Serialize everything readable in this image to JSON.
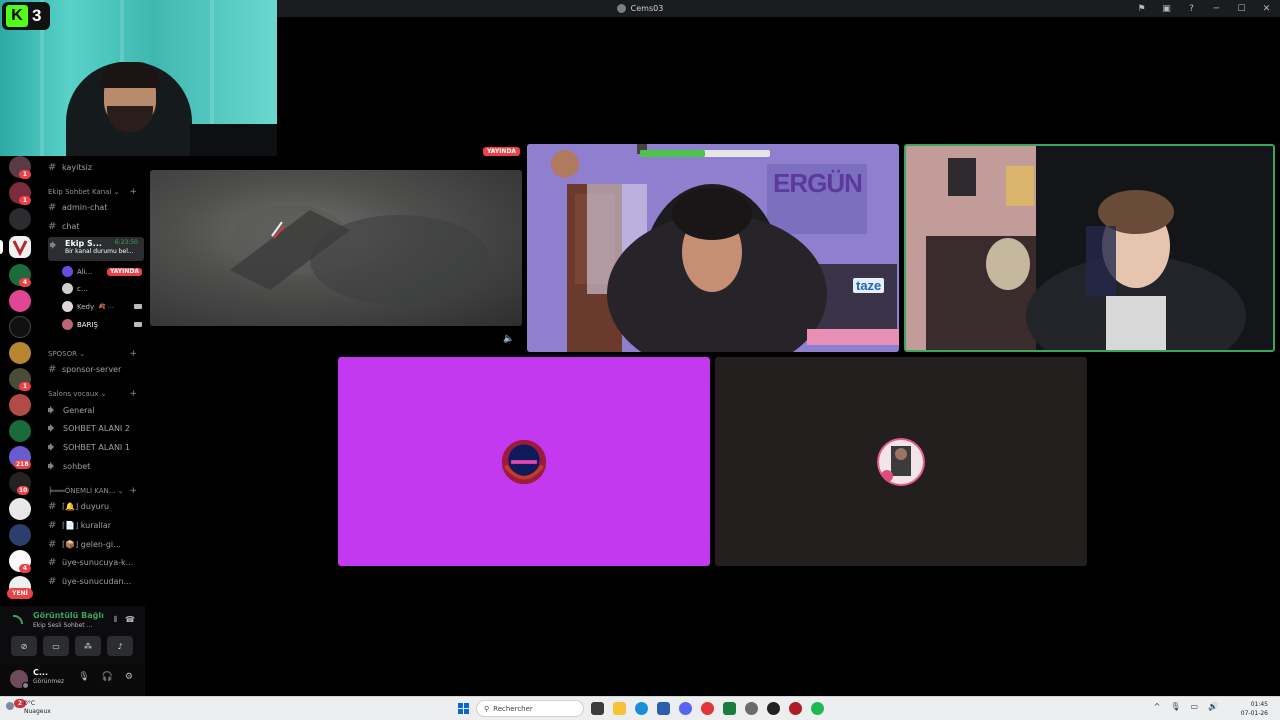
{
  "window": {
    "title": "Cems03",
    "controls": [
      "notifications-icon",
      "inbox-icon",
      "help-icon",
      "minimize",
      "maximize",
      "close"
    ]
  },
  "overlay": {
    "kick_number": "3"
  },
  "channels": {
    "items": [
      {
        "type": "text",
        "label": "kayitsiz"
      },
      {
        "type": "category",
        "label": "Ekip Sohbet Kanal ⌄"
      },
      {
        "type": "text",
        "label": "admin-chat"
      },
      {
        "type": "text",
        "label": "chat"
      },
      {
        "type": "voice",
        "label": "Ekip S...",
        "time": "6:23:50",
        "status": "Bir kanal durumu bel..."
      },
      {
        "type": "category",
        "label": "SPOSOR ⌄"
      },
      {
        "type": "text",
        "label": "sponsor-server"
      },
      {
        "type": "category",
        "label": "Salons vocaux ⌄"
      },
      {
        "type": "voice",
        "label": "General"
      },
      {
        "type": "voice",
        "label": "SOHBET ALANI 2"
      },
      {
        "type": "voice",
        "label": "SOHBET ALANI 1"
      },
      {
        "type": "voice",
        "label": "sohbet"
      },
      {
        "type": "category",
        "label": "╞═══ÖNEMLİ KAN... ⌄"
      },
      {
        "type": "text",
        "label": "⌈🔔⌋ duyuru"
      },
      {
        "type": "text",
        "label": "⌈📄⌋ kurallar"
      },
      {
        "type": "text",
        "label": "⌈📦⌋ gelen-gi..."
      },
      {
        "type": "text",
        "label": "üye-sunucuya-k..."
      },
      {
        "type": "text",
        "label": "üye-sunucudan..."
      }
    ],
    "voice_users": [
      {
        "name": "Ali...",
        "live": "YAYINDA",
        "color": "#6a4de0"
      },
      {
        "name": "c...",
        "color": "#cfcfcf"
      },
      {
        "name": "Kedy",
        "color": "#e0d6d6",
        "extra": "🍂 ..."
      },
      {
        "name": "BARIŞ",
        "color": "#c0647a"
      }
    ]
  },
  "servers": {
    "badges": [
      "1",
      "4",
      "1",
      "218",
      "10",
      "4"
    ],
    "new_label": "YENİ"
  },
  "voice_panel": {
    "status": "Görüntülü Bağlı",
    "channel": "Ekip Sesli Sohbet ..."
  },
  "user_panel": {
    "name": "C...",
    "status": "Görünmez"
  },
  "stage": {
    "live_label": "YAYINDA",
    "overlay_texts": {
      "cam1_sign": "ERGÜN",
      "cam1_sign2": "taze"
    }
  },
  "taskbar": {
    "weather_temp": "0°C",
    "weather_cond": "Nuageux",
    "weather_badge": "2",
    "search_placeholder": "Rechercher",
    "time": "01:45",
    "date": "07-01-26"
  }
}
